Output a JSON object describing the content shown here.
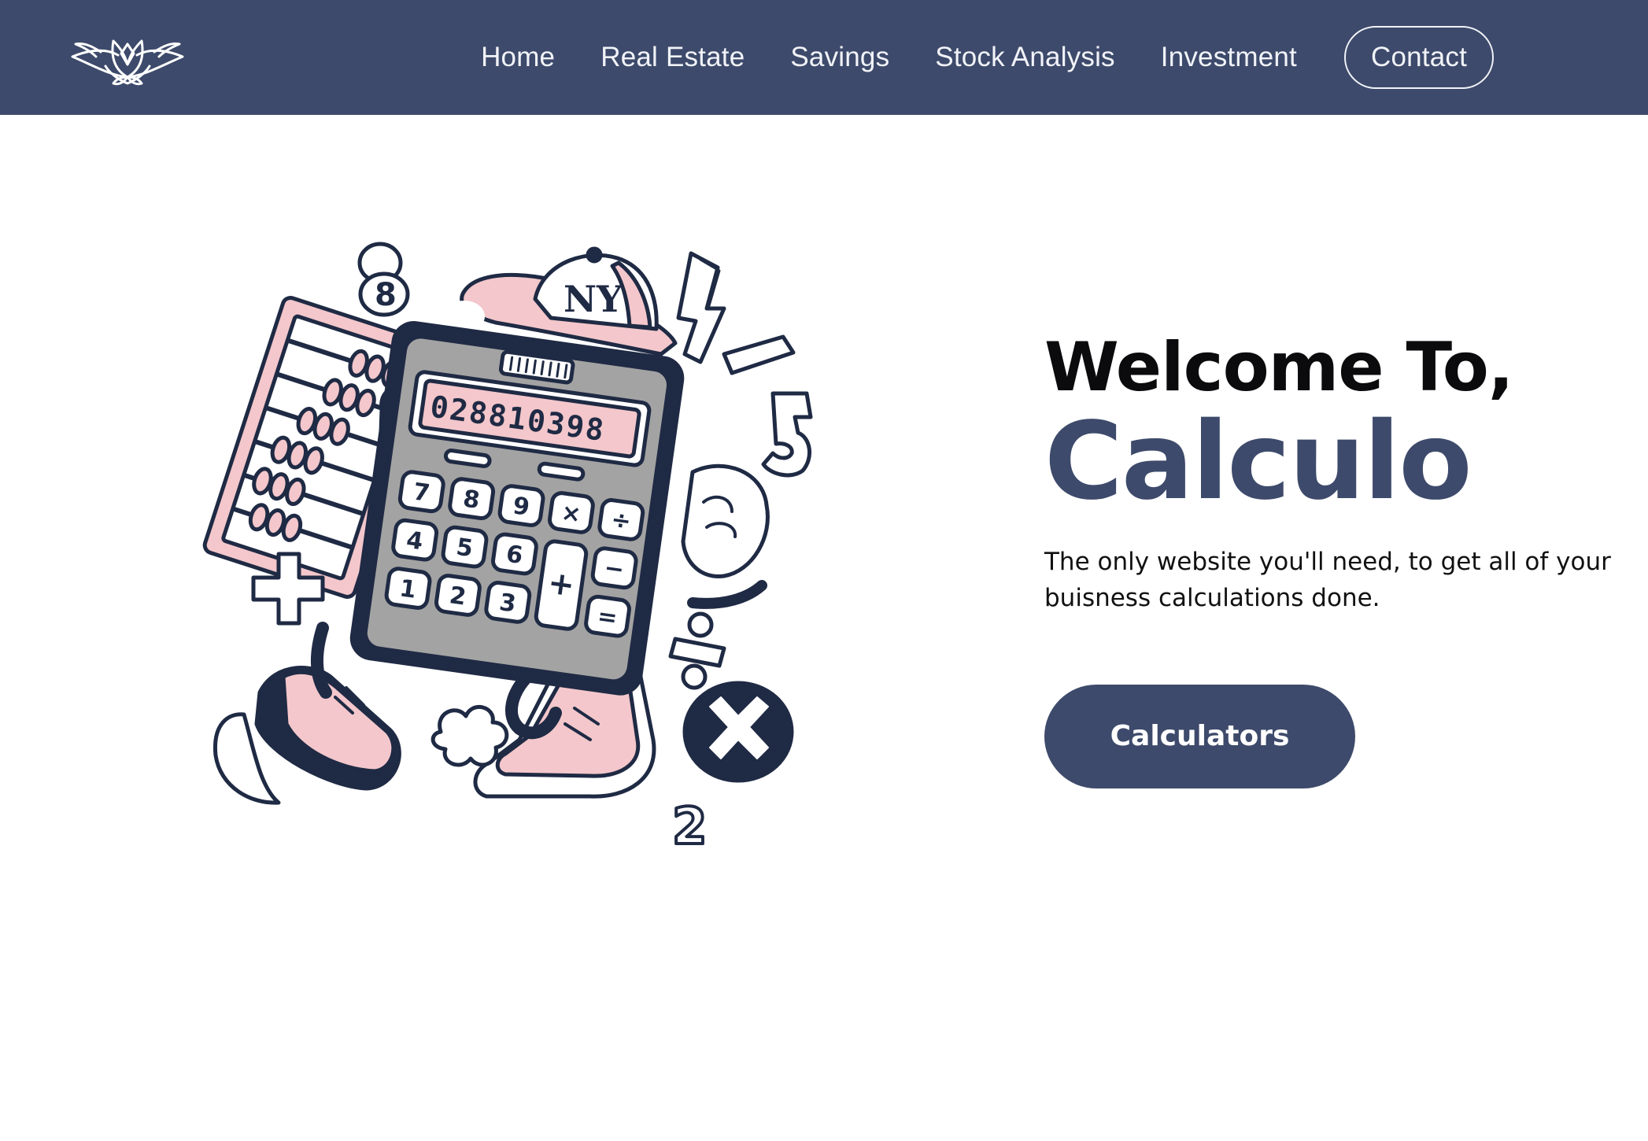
{
  "brand": {
    "logo": "lotus-logo-icon"
  },
  "nav": {
    "items": [
      {
        "label": "Home"
      },
      {
        "label": "Real Estate"
      },
      {
        "label": "Savings"
      },
      {
        "label": "Stock Analysis"
      },
      {
        "label": "Investment"
      }
    ],
    "contact_label": "Contact"
  },
  "hero": {
    "welcome": "Welcome To,",
    "brand_name": "Calculo",
    "tagline": "The only website you'll need, to get all of your buisness calculations done.",
    "cta_label": "Calculators",
    "illustration": {
      "icon": "calculator-mascot-illustration",
      "display_value": "028810398",
      "cap_letters": "NY",
      "keys": [
        {
          "label": "7"
        },
        {
          "label": "8"
        },
        {
          "label": "9"
        },
        {
          "label": "×"
        },
        {
          "label": "÷"
        },
        {
          "label": "4"
        },
        {
          "label": "5"
        },
        {
          "label": "6"
        },
        {
          "label": "+"
        },
        {
          "label": "−"
        },
        {
          "label": "1"
        },
        {
          "label": "2"
        },
        {
          "label": "3"
        },
        {
          "label": "="
        }
      ],
      "floating_numbers": [
        {
          "label": "8"
        },
        {
          "label": "5"
        },
        {
          "label": "2"
        }
      ]
    }
  },
  "colors": {
    "navbar_bg": "#3d4a6b",
    "accent": "#3d4a6b",
    "pink": "#f3c7cb",
    "outline": "#1f2a44",
    "calc_body": "#a3a3a3"
  }
}
